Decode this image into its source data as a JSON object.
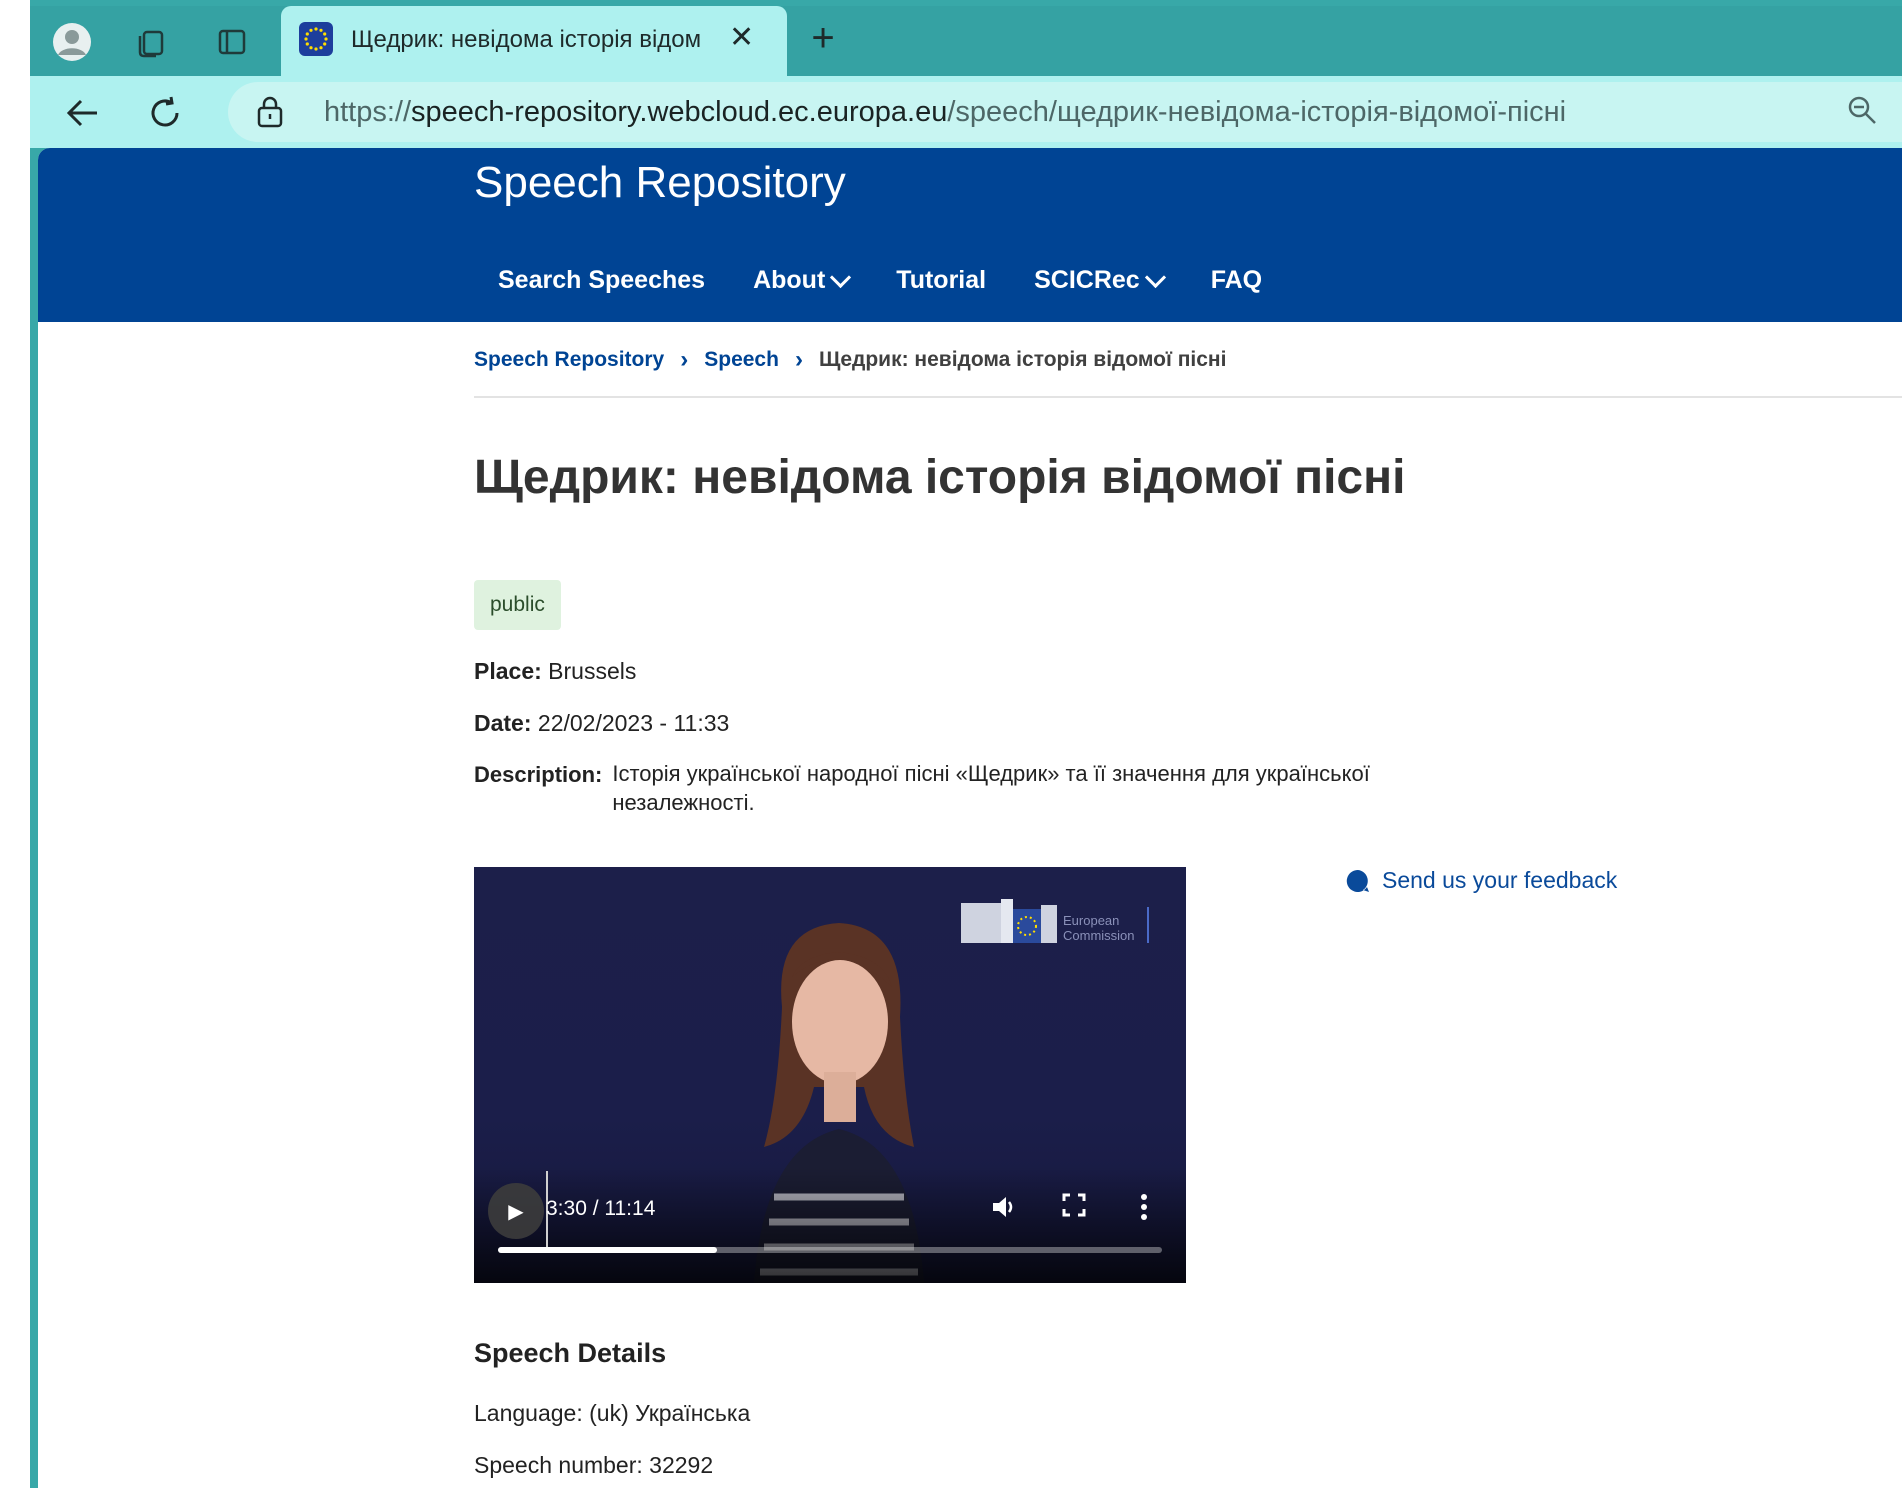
{
  "browser": {
    "tab_title": "Щедрик: невідома історія відомої пісні",
    "url_prefix": "https://",
    "url_host": "speech-repository.webcloud.ec.europa.eu",
    "url_path": "/speech/щедрик-невідома-історія-відомої-пісні"
  },
  "site": {
    "title": "Speech Repository",
    "nav": [
      {
        "label": "Search Speeches",
        "dropdown": false
      },
      {
        "label": "About",
        "dropdown": true
      },
      {
        "label": "Tutorial",
        "dropdown": false
      },
      {
        "label": "SCICRec",
        "dropdown": true
      },
      {
        "label": "FAQ",
        "dropdown": false
      }
    ]
  },
  "breadcrumb": {
    "items": [
      "Speech Repository",
      "Speech"
    ],
    "current": "Щедрик: невідома історія відомої пісні"
  },
  "speech": {
    "title": "Щедрик: невідома історія відомої пісні",
    "badge": "public",
    "place_label": "Place:",
    "place": "Brussels",
    "date_label": "Date:",
    "date": "22/02/2023 - 11:33",
    "description_label": "Description:",
    "description": "Історія української народної пісні «Щедрик» та її значення для української незалежності."
  },
  "video": {
    "time_display": "3:30 / 11:14",
    "progress": 0.33,
    "logo_text_1": "European",
    "logo_text_2": "Commission"
  },
  "feedback": {
    "label": "Send us your feedback"
  },
  "details": {
    "title": "Speech Details",
    "language": "Language: (uk) Українська",
    "speech_number": "Speech number: 32292"
  },
  "colors": {
    "header_blue": "#004494",
    "link_blue": "#0a4a9a",
    "badge_green": "#dff2df",
    "chrome_teal": "#35a2a3"
  }
}
